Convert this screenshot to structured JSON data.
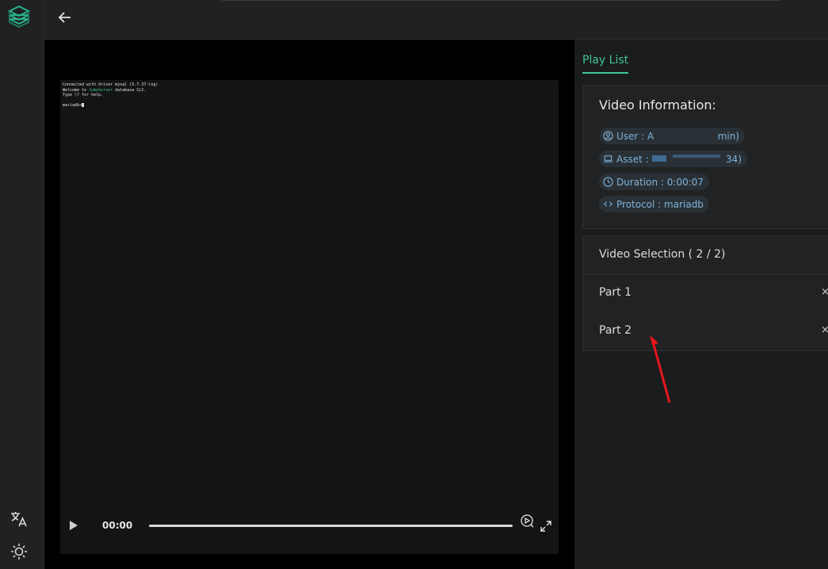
{
  "colors": {
    "accent": "#3fc796",
    "chip_text": "#7fb2da",
    "chip_bg": "#2a3136",
    "annotation": "#e8161c"
  },
  "icons": {
    "logo": "layered-cube-logo-icon",
    "back": "arrow-left-icon",
    "translate": "translate-icon",
    "theme": "sun-icon",
    "play": "play-icon",
    "speed": "playback-speed-icon",
    "fullscreen": "fullscreen-icon"
  },
  "terminal": {
    "line1": "Connected with driver mysql (5.7.37-log)",
    "line2_pre": "Welcome to ",
    "line2_hl": "JumpServer",
    "line2_post": " database CLI.",
    "line3": "Type \\? for help.",
    "prompt": "mariadb>"
  },
  "controls": {
    "time": "00:00",
    "progress": 0
  },
  "right": {
    "tab_label": "Play List",
    "info": {
      "title": "Video Information:",
      "user_prefix": "User : A",
      "user_suffix": "min)",
      "asset_prefix": "Asset : ",
      "asset_suffix": "34)",
      "duration": "Duration : 0:00:07",
      "protocol": "Protocol : mariadb"
    },
    "selection": {
      "title": "Video Selection ( 2 / 2)",
      "parts": [
        {
          "label": "Part 1",
          "close": "×"
        },
        {
          "label": "Part 2",
          "close": "×"
        }
      ]
    }
  }
}
